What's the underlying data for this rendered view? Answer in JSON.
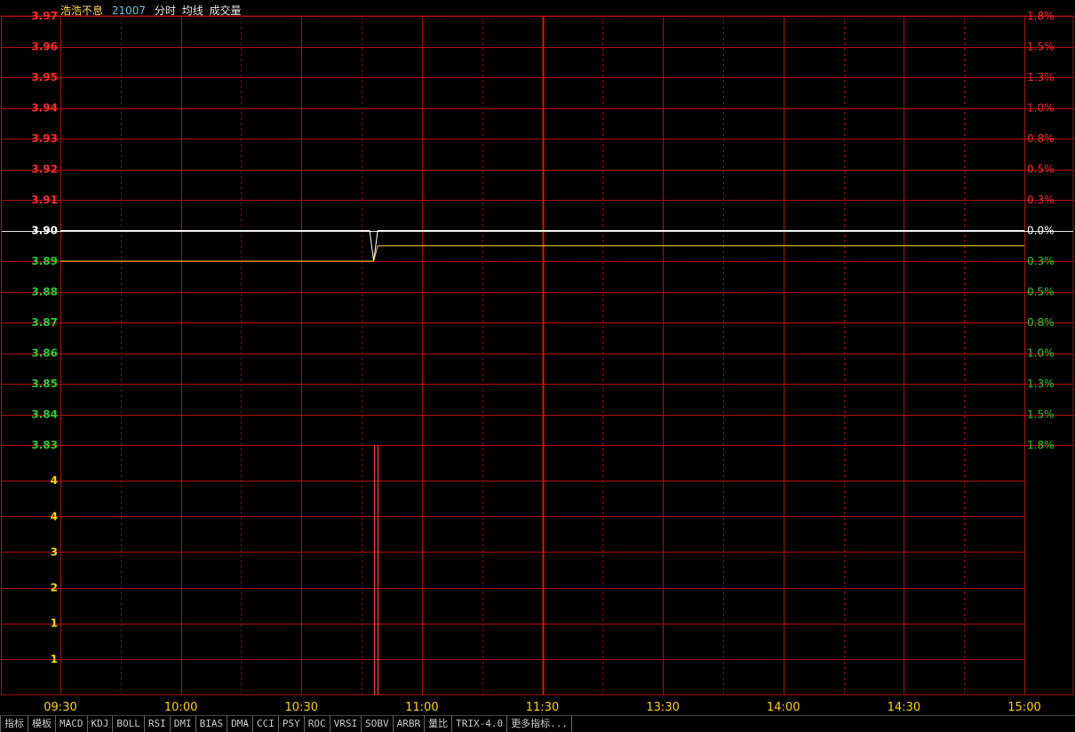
{
  "header": {
    "stock_name": "浩浩不息",
    "code": "21007",
    "indicators": [
      "分时",
      "均线",
      "成交量"
    ]
  },
  "colors": {
    "grid": "#b01010",
    "grid_dashed": "#8a0a0a",
    "up": "#ff2a2a",
    "down": "#2ecc2e",
    "flat": "#ffffff",
    "price_line": "#ffffff",
    "avg_line": "#ffd400",
    "volume": "#ff4040",
    "vol_label": "#ffd400",
    "time_label": "#ffd400"
  },
  "chart_data": {
    "type": "line",
    "title": "",
    "reference_price": 3.9,
    "price_axis": {
      "ticks": [
        3.97,
        3.96,
        3.95,
        3.94,
        3.93,
        3.92,
        3.91,
        3.9,
        3.89,
        3.88,
        3.87,
        3.86,
        3.85,
        3.84,
        3.83
      ],
      "tick_labels": [
        "3.97",
        "3.96",
        "3.95",
        "3.94",
        "3.93",
        "3.92",
        "3.91",
        "3.90",
        "3.89",
        "3.88",
        "3.87",
        "3.86",
        "3.85",
        "3.84",
        "3.83"
      ],
      "ylim": [
        3.83,
        3.97
      ]
    },
    "pct_axis": {
      "tick_labels": [
        "1.8%",
        "1.5%",
        "1.3%",
        "1.0%",
        "0.8%",
        "0.5%",
        "0.3%",
        "0.0%",
        "0.3%",
        "0.5%",
        "0.8%",
        "1.0%",
        "1.3%",
        "1.5%",
        "1.8%"
      ]
    },
    "volume_axis": {
      "tick_labels": [
        "4",
        "4",
        "3",
        "2",
        "1",
        "1"
      ]
    },
    "time_axis": {
      "tick_labels": [
        "09:30",
        "10:00",
        "10:30",
        "11:00",
        "11:30",
        "13:30",
        "14:00",
        "14:30",
        "15:00"
      ],
      "minutes_total": 240
    },
    "series": [
      {
        "name": "分时",
        "x_minutes": [
          0,
          77,
          78,
          79,
          80,
          240
        ],
        "values": [
          3.9,
          3.9,
          3.89,
          3.9,
          3.9,
          3.9
        ]
      },
      {
        "name": "均线",
        "x_minutes": [
          0,
          77,
          78,
          79,
          240
        ],
        "values": [
          3.89,
          3.89,
          3.89,
          3.895,
          3.895
        ]
      }
    ],
    "volume": {
      "x_minutes": [
        78,
        79
      ],
      "values": [
        5,
        5
      ]
    },
    "grid": true
  },
  "tabs": [
    "指标",
    "模板",
    "MACD",
    "KDJ",
    "BOLL",
    "RSI",
    "DMI",
    "BIAS",
    "DMA",
    "CCI",
    "PSY",
    "ROC",
    "VRSI",
    "SOBV",
    "ARBR",
    "量比",
    "TRIX-4.0",
    "更多指标..."
  ]
}
